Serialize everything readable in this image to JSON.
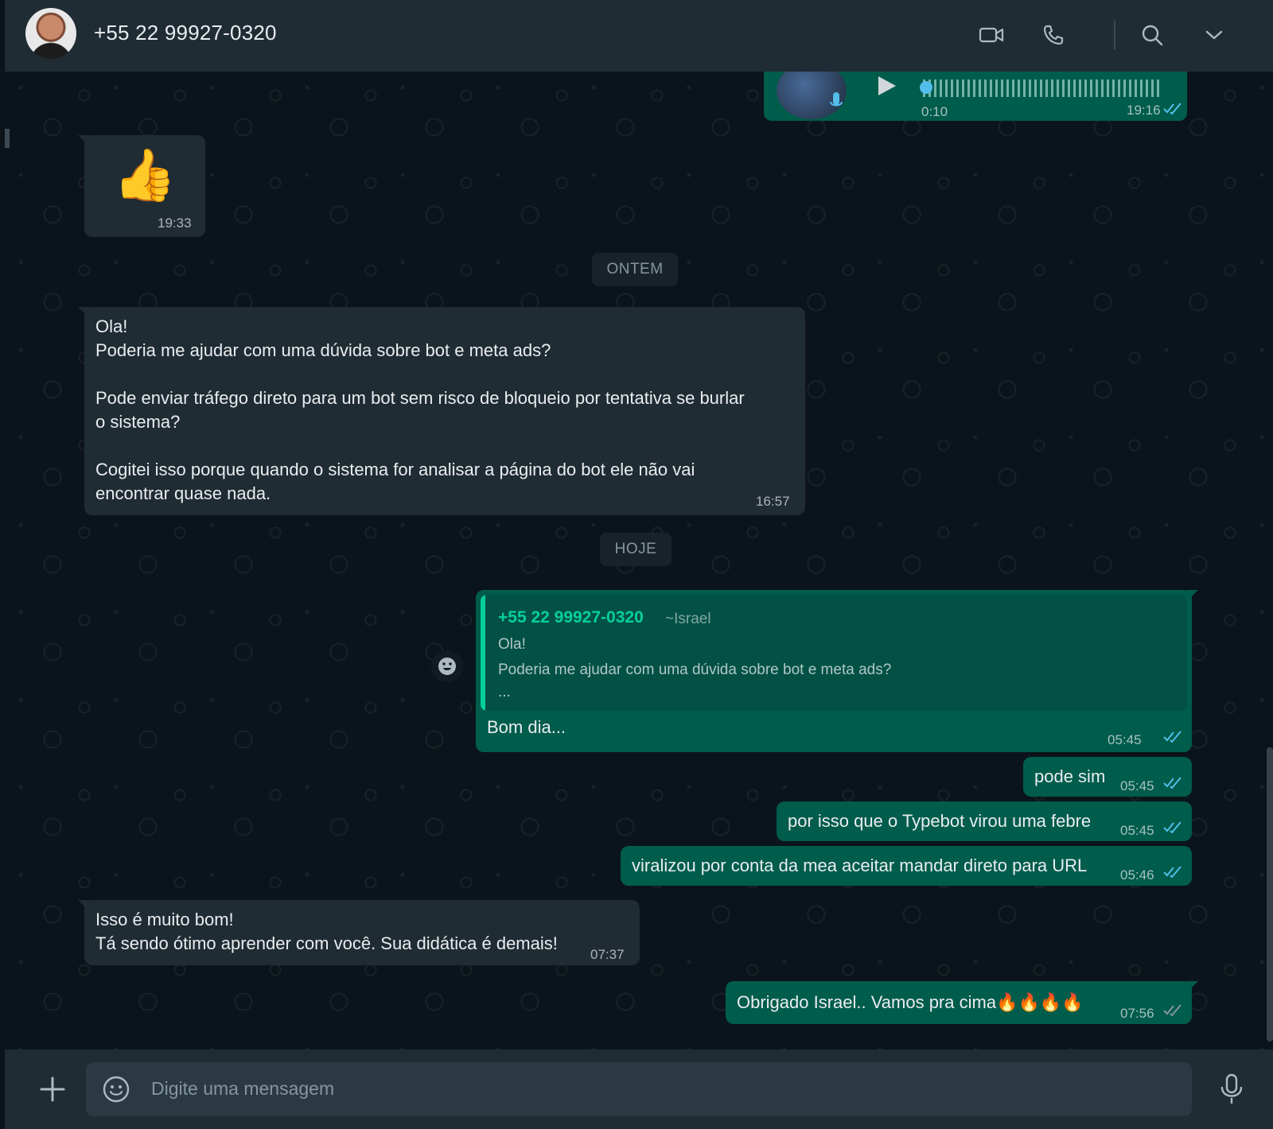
{
  "header": {
    "contact_name": "+55 22 99927-0320",
    "icons": [
      "video-call-icon",
      "voice-call-icon",
      "search-icon",
      "chevron-down-icon"
    ]
  },
  "messages": {
    "audio": {
      "duration": "0:10",
      "time": "19:16"
    },
    "thumbs": {
      "emoji": "👍",
      "time": "19:33"
    },
    "day1": "ONTEM",
    "question": {
      "lines": [
        "Ola!",
        "Poderia me ajudar com uma dúvida sobre bot e meta ads?",
        "",
        "Pode enviar tráfego direto para um bot sem risco de bloqueio por tentativa se burlar",
        "o sistema?",
        "",
        "Cogitei isso porque quando o sistema for analisar a página do bot ele não vai",
        "encontrar quase nada."
      ],
      "time": "16:57"
    },
    "day2": "HOJE",
    "reply": {
      "quote_author": "+55 22 99927-0320",
      "quote_name": "~Israel",
      "quote_line1": "Ola!",
      "quote_line2": "Poderia me ajudar com uma dúvida sobre bot e meta ads?",
      "quote_more": "...",
      "text": "Bom dia...",
      "time": "05:45"
    },
    "out1": {
      "text": "pode sim",
      "time": "05:45"
    },
    "out2": {
      "text": "por isso que o Typebot virou uma febre",
      "time": "05:45"
    },
    "out3": {
      "text": "viralizou por conta da mea aceitar mandar direto para URL",
      "time": "05:46"
    },
    "in2": {
      "line1": "Isso é muito bom!",
      "line2": "Tá sendo ótimo aprender com você. Sua didática é demais!",
      "time": "07:37"
    },
    "out4": {
      "text": "Obrigado Israel.. Vamos pra cima🔥🔥🔥🔥",
      "time": "07:56"
    }
  },
  "footer": {
    "placeholder": "Digite uma mensagem"
  },
  "colors": {
    "accent": "#00a884",
    "outgoing": "#005c4b",
    "incoming": "#202c33",
    "tick": "#53bdeb"
  }
}
